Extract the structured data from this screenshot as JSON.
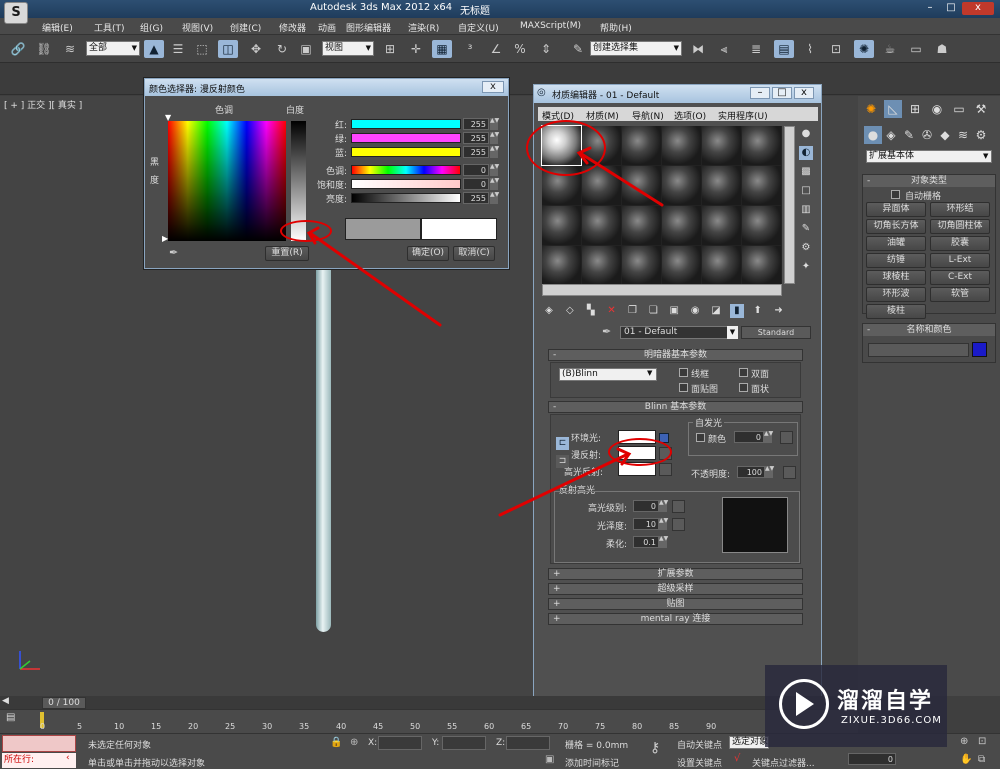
{
  "titlebar": {
    "app_title": "Autodesk 3ds Max 2012 x64",
    "file_title": "无标题",
    "min": "–",
    "max": "□",
    "close": "x"
  },
  "menubar": [
    "编辑(E)",
    "工具(T)",
    "组(G)",
    "视图(V)",
    "创建(C)",
    "修改器",
    "动画",
    "图形编辑器",
    "渲染(R)",
    "自定义(U)",
    "MAXScript(M)",
    "帮助(H)"
  ],
  "toolbar": {
    "selection_filter": "全部",
    "ref_coord": "视图",
    "named_selection": "创建选择集"
  },
  "viewport": {
    "label": "[ + ] 正交 ][ 真实 ]"
  },
  "color_picker": {
    "title": "颜色选择器: 漫反射颜色",
    "hue_label": "色调",
    "white_label": "白度",
    "black_label": "黑度",
    "channels": [
      {
        "label": "红:",
        "value": "255",
        "color": "#00ffff"
      },
      {
        "label": "绿:",
        "value": "255",
        "color": "#ff44ff"
      },
      {
        "label": "蓝:",
        "value": "255",
        "color": "#ffff00"
      },
      {
        "label": "色调:",
        "value": "0",
        "color": "rainbow"
      },
      {
        "label": "饱和度:",
        "value": "0",
        "color": "#ffe6e6"
      },
      {
        "label": "亮度:",
        "value": "255",
        "color": "gray"
      }
    ],
    "reset_button": "重置(R)",
    "ok_button": "确定(O)",
    "cancel_button": "取消(C)"
  },
  "material_editor": {
    "title": "材质编辑器 - 01 - Default",
    "menus": [
      "模式(D)",
      "材质(M)",
      "导航(N)",
      "选项(O)",
      "实用程序(U)"
    ],
    "material_name": "01 - Default",
    "material_type": "Standard",
    "shader_rollout": "明暗器基本参数",
    "shader_type": "(B)Blinn",
    "shader_options": [
      "线框",
      "双面",
      "面贴图",
      "面状"
    ],
    "blinn_rollout": "Blinn 基本参数",
    "self_illum_label": "自发光",
    "self_illum_color_label": "颜色",
    "self_illum_value": "0",
    "ambient_label": "环境光:",
    "diffuse_label": "漫反射:",
    "specular_label": "高光反射:",
    "opacity_label": "不透明度:",
    "opacity_value": "100",
    "spec_highlights_label": "反射高光",
    "spec_level_label": "高光级别:",
    "spec_level_value": "0",
    "glossiness_label": "光泽度:",
    "glossiness_value": "10",
    "soften_label": "柔化:",
    "soften_value": "0.1",
    "collapsed_rollouts": [
      "扩展参数",
      "超级采样",
      "贴图",
      "mental ray 连接"
    ]
  },
  "command_panel": {
    "category": "扩展基本体",
    "object_type_head": "对象类型",
    "autogrid_label": "自动栅格",
    "buttons": [
      "异面体",
      "环形结",
      "切角长方体",
      "切角圆柱体",
      "油罐",
      "胶囊",
      "纺锤",
      "L-Ext",
      "球棱柱",
      "C-Ext",
      "环形波",
      "软管",
      "棱柱"
    ],
    "name_color_head": "名称和颜色",
    "object_color": "#1a1ac8"
  },
  "timeline": {
    "frame_label": "0 / 100",
    "ticks": [
      "0",
      "5",
      "10",
      "15",
      "20",
      "25",
      "30",
      "35",
      "40",
      "45",
      "50",
      "55",
      "60",
      "65",
      "70",
      "75",
      "80",
      "85",
      "90"
    ]
  },
  "statusbar": {
    "script_label": "所在行:",
    "status1": "未选定任何对象",
    "status2": "单击或单击并拖动以选择对象",
    "x_label": "X:",
    "y_label": "Y:",
    "z_label": "Z:",
    "grid_label": "栅格 = 0.0mm",
    "add_time_tag": "添加时间标记",
    "auto_key": "自动关键点",
    "set_key": "设置关键点",
    "selected_dd": "选定对象",
    "key_filters": "关键点过滤器...",
    "frame_value": "0"
  },
  "watermark": {
    "title": "溜溜自学",
    "url": "ZIXUE.3D66.COM"
  }
}
